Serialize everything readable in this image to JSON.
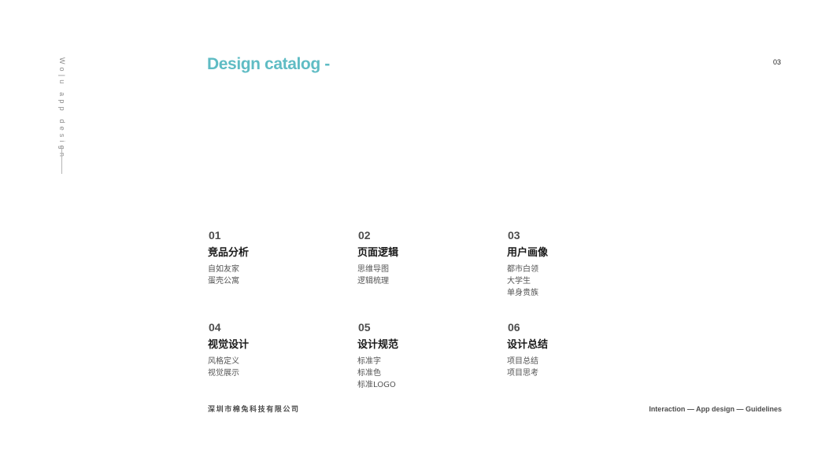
{
  "side_brand": {
    "text": "Wo|u app design"
  },
  "header": {
    "title": "Design catalog -",
    "page_number": "03"
  },
  "sections": [
    {
      "number": "01",
      "title": "竞品分析",
      "items": [
        "自如友家",
        "蛋壳公寓"
      ]
    },
    {
      "number": "02",
      "title": "页面逻辑",
      "items": [
        "思维导图",
        "逻辑梳理"
      ]
    },
    {
      "number": "03",
      "title": "用户画像",
      "items": [
        "都市白领",
        "大学生",
        "单身贵族"
      ]
    },
    {
      "number": "04",
      "title": "视觉设计",
      "items": [
        "风格定义",
        "视觉展示"
      ]
    },
    {
      "number": "05",
      "title": "设计规范",
      "items": [
        "标准字",
        "标准色",
        "标准LOGO"
      ]
    },
    {
      "number": "06",
      "title": "设计总结",
      "items": [
        "项目总结",
        "项目思考"
      ]
    }
  ],
  "footer": {
    "company": "深圳市棉兔科技有限公司",
    "tagline": "Interaction — App design — Guidelines"
  },
  "colors": {
    "accent": "#5fbcc4",
    "text_dark": "#1a1a1a",
    "text_muted": "#555555"
  }
}
